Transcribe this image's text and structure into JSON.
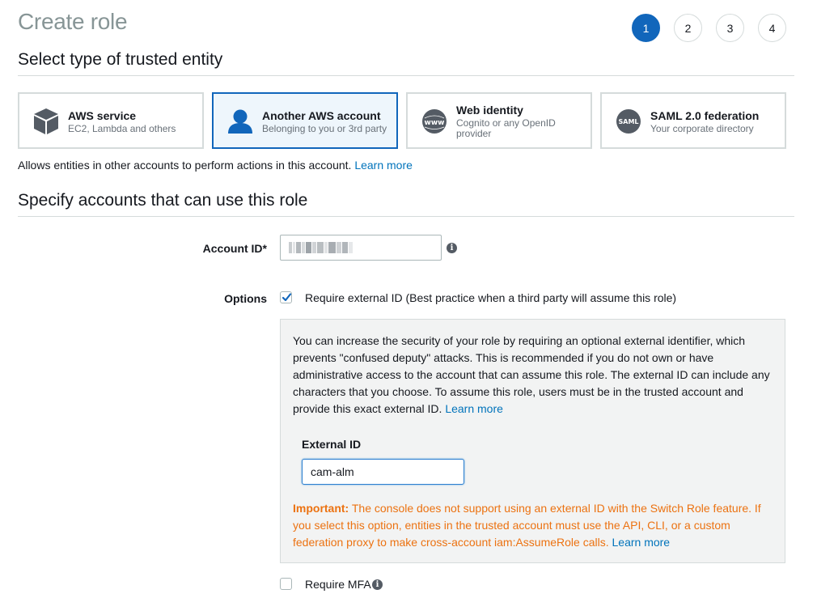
{
  "page_title": "Create role",
  "steps": [
    "1",
    "2",
    "3",
    "4"
  ],
  "active_step": "1",
  "section_trusted_entity": "Select type of trusted entity",
  "tiles": [
    {
      "title": "AWS service",
      "subtitle": "EC2, Lambda and others",
      "icon": "cube-icon"
    },
    {
      "title": "Another AWS account",
      "subtitle": "Belonging to you or 3rd party",
      "icon": "user-icon"
    },
    {
      "title": "Web identity",
      "subtitle": "Cognito or any OpenID provider",
      "icon": "www-globe-icon"
    },
    {
      "title": "SAML 2.0 federation",
      "subtitle": "Your corporate directory",
      "icon": "saml-icon",
      "icon_text": "SAML"
    }
  ],
  "selected_tile": "Another AWS account",
  "entity_hint": "Allows entities in other accounts to perform actions in this account.",
  "learn_more": "Learn more",
  "section_accounts": "Specify accounts that can use this role",
  "account_id_label": "Account ID*",
  "options_label": "Options",
  "require_external_id_label": "Require external ID (Best practice when a third party will assume this role)",
  "require_external_id_checked": true,
  "external_id_info": "You can increase the security of your role by requiring an optional external identifier, which prevents \"confused deputy\" attacks. This is recommended if you do not own or have administrative access to the account that can assume this role. The external ID can include any characters that you choose. To assume this role, users must be in the trusted account and provide this exact external ID.",
  "external_id_label": "External ID",
  "external_id_value": "cam-alm",
  "important_label": "Important:",
  "important_text": "The console does not support using an external ID with the Switch Role feature. If you select this option, entities in the trusted account must use the API, CLI, or a custom federation proxy to make cross-account iam:AssumeRole calls.",
  "require_mfa_label": "Require MFA",
  "require_mfa_checked": false,
  "colors": {
    "accent": "#1166bb",
    "link": "#0073bb",
    "warning": "#ec7211",
    "muted_title": "#879596"
  }
}
